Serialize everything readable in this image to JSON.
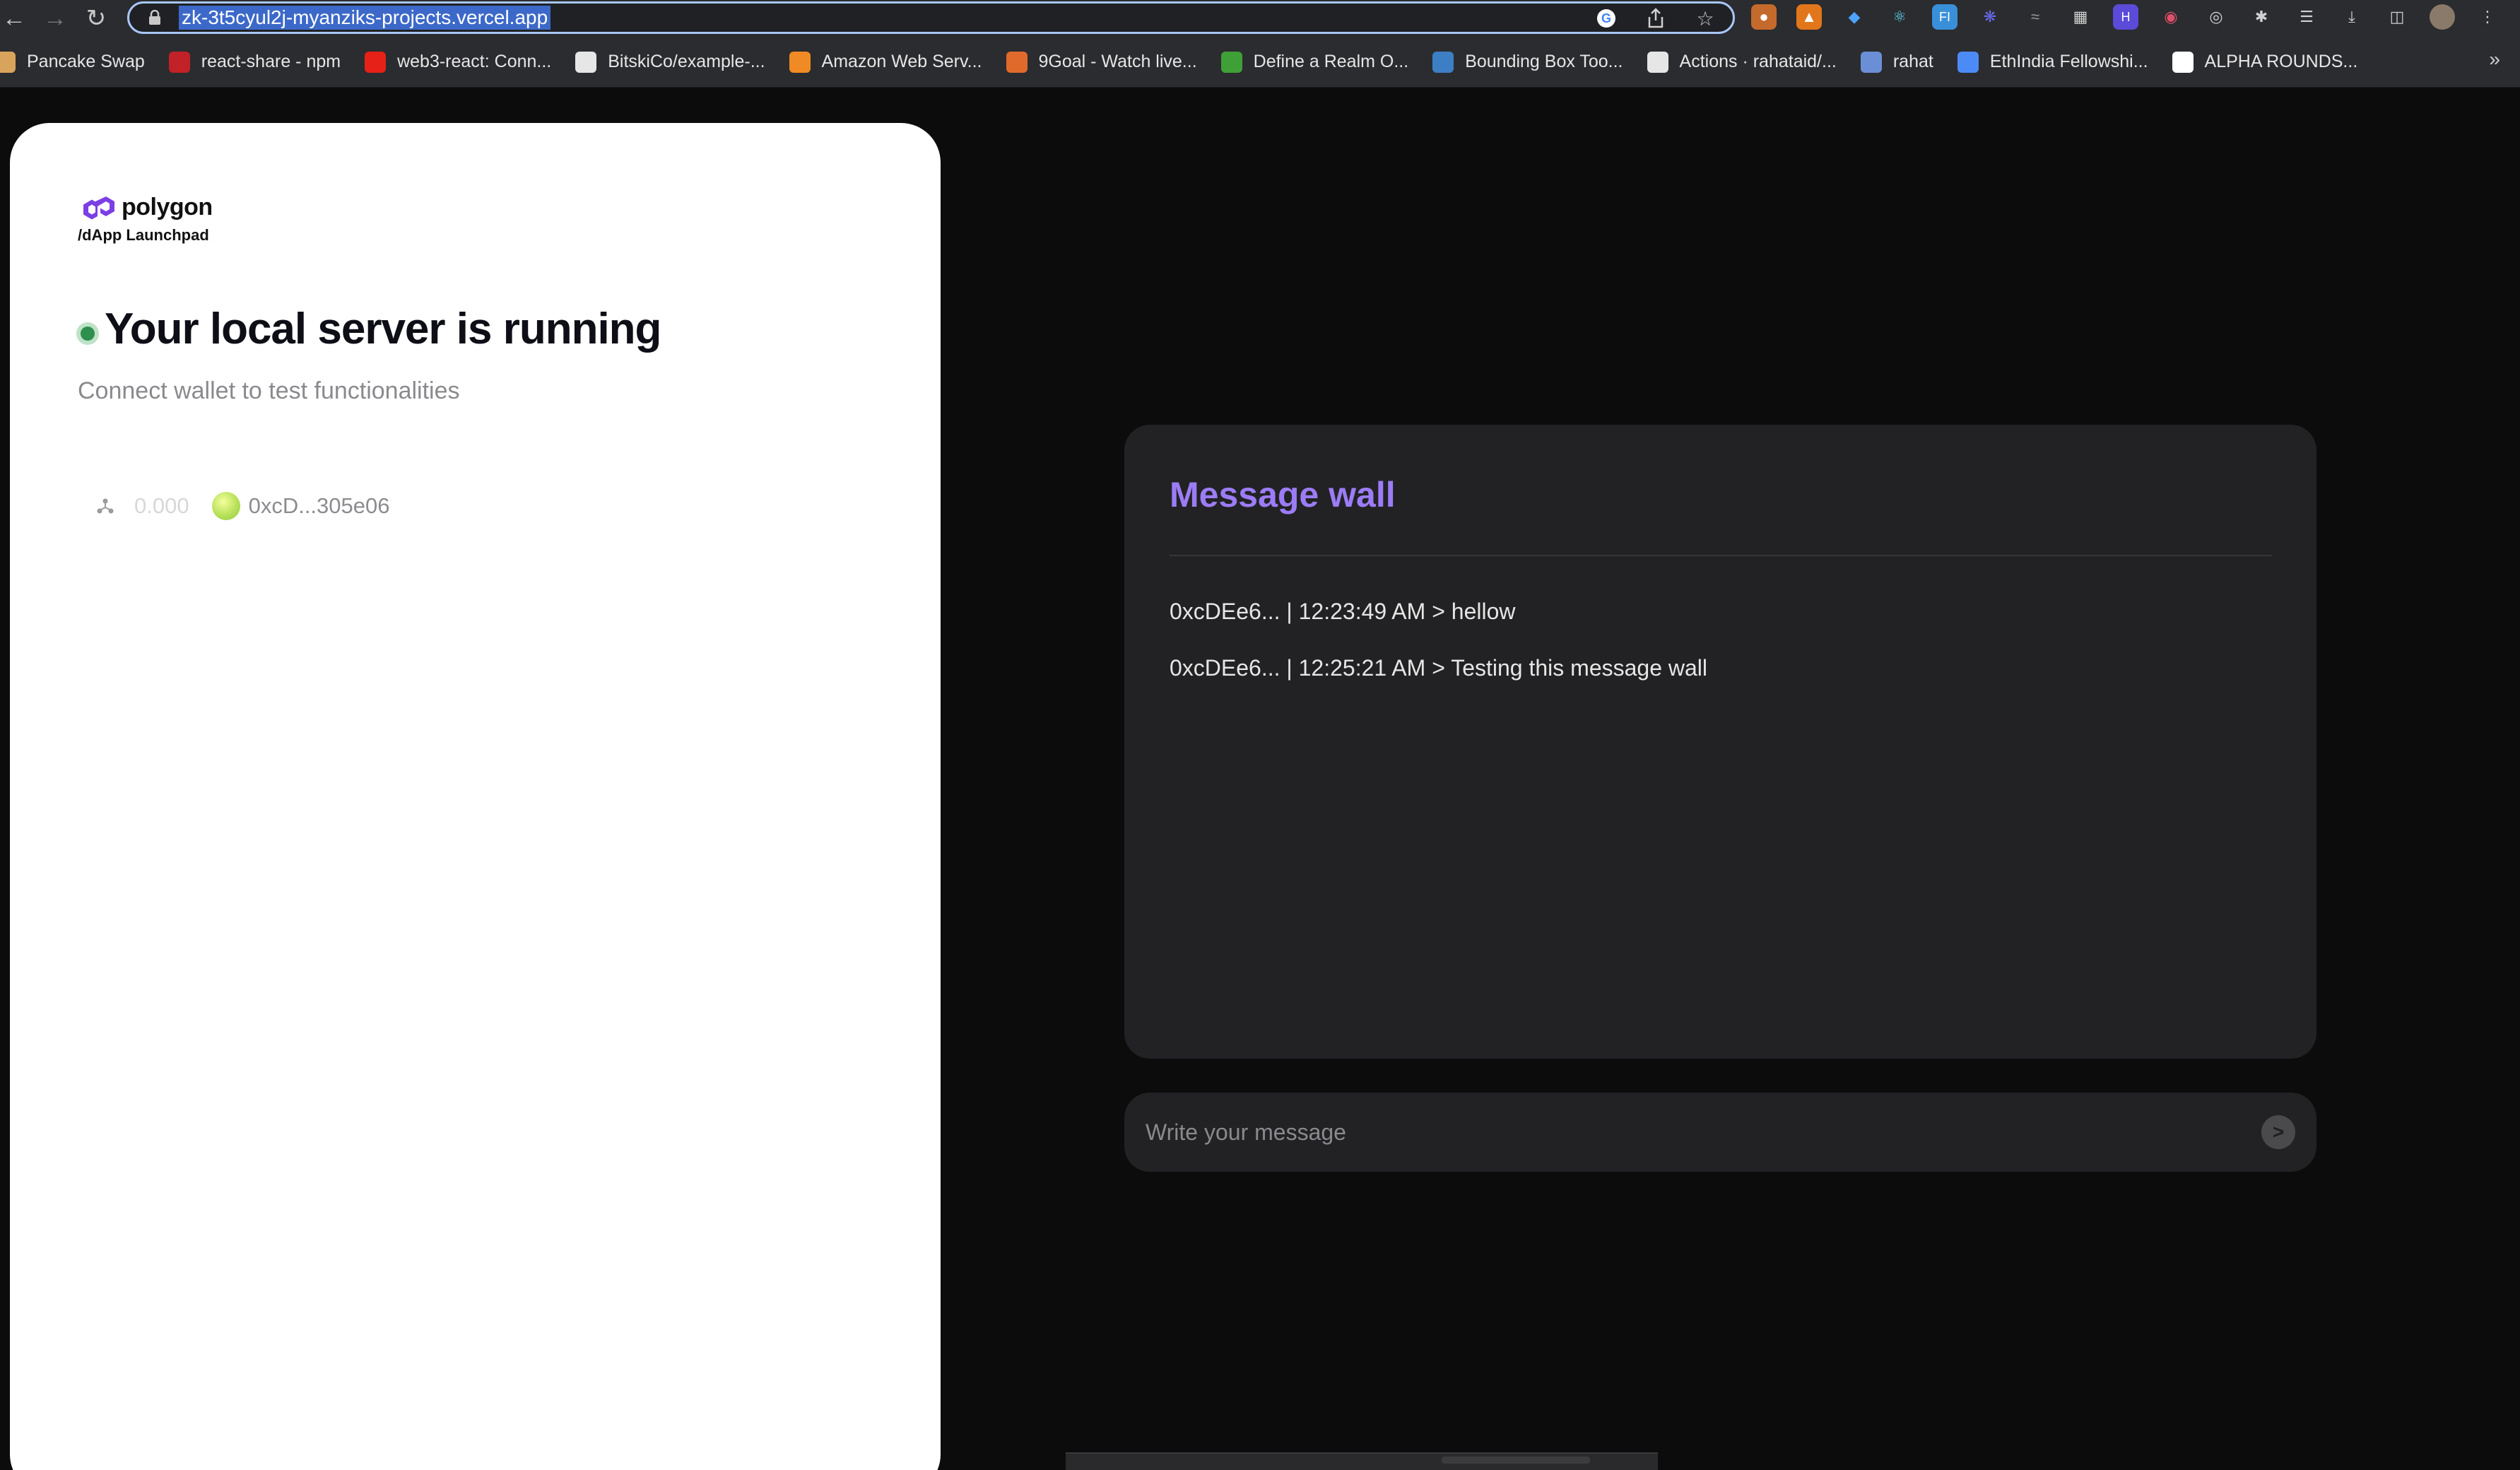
{
  "browser": {
    "url": "zk-3t5cyul2j-myanziks-projects.vercel.app",
    "bookmarks": [
      {
        "label": "Pancake Swap",
        "icon": "pancake-icon",
        "color": "#d8a45c"
      },
      {
        "label": "react-share - npm",
        "icon": "npm-icon",
        "color": "#c12127"
      },
      {
        "label": "web3-react: Conn...",
        "icon": "youtube-icon",
        "color": "#e62117"
      },
      {
        "label": "BitskiCo/example-...",
        "icon": "github-icon",
        "color": "#e6e6e6"
      },
      {
        "label": "Amazon Web Serv...",
        "icon": "aws-icon",
        "color": "#f08a24"
      },
      {
        "label": "9Goal - Watch live...",
        "icon": "9goal-icon",
        "color": "#e06a2c"
      },
      {
        "label": "Define a Realm O...",
        "icon": "mongodb-icon",
        "color": "#3fa037"
      },
      {
        "label": "Bounding Box Too...",
        "icon": "bbox-icon",
        "color": "#3d7fc4"
      },
      {
        "label": "Actions · rahataid/...",
        "icon": "github-icon",
        "color": "#e6e6e6"
      },
      {
        "label": "rahat",
        "icon": "rahat-icon",
        "color": "#6b8fd6"
      },
      {
        "label": "EthIndia Fellowshi...",
        "icon": "docs-icon",
        "color": "#4c8bf5"
      },
      {
        "label": "ALPHA ROUNDS...",
        "icon": "notion-icon",
        "color": "#ffffff"
      }
    ],
    "more": "»"
  },
  "app": {
    "brand": "polygon",
    "brand_sub": "/dApp Launchpad",
    "headline": "Your local server is running",
    "subline": "Connect wallet to test functionalities",
    "balance": "0.000",
    "address": "0xcD...305e06",
    "accent": "#9c7cf6",
    "status_color": "#2f8f4e"
  },
  "wall": {
    "title": "Message wall",
    "messages": [
      "0xcDEe6... | 12:23:49 AM > hellow",
      "0xcDEe6... | 12:25:21 AM > Testing this message wall"
    ],
    "input_placeholder": "Write your message",
    "send_label": ">"
  }
}
